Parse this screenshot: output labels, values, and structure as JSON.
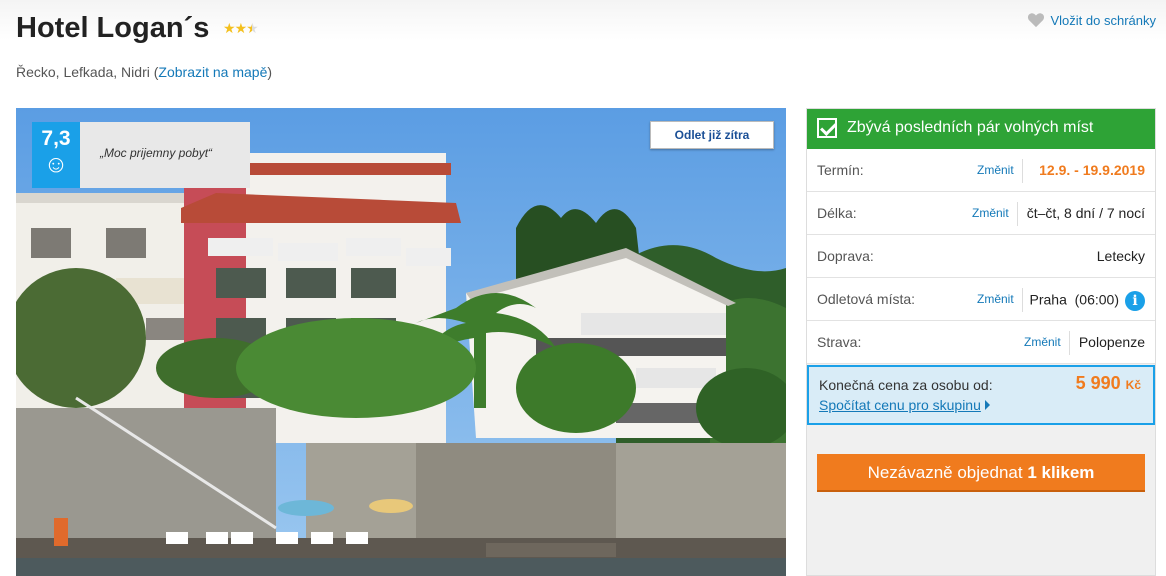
{
  "hotel": {
    "name": "Hotel Logan´s",
    "stars": 2.5,
    "location_prefix": "Řecko, Lefkada, Nidri (",
    "map_link": "Zobrazit na mapě",
    "location_suffix": ")"
  },
  "favorites": {
    "label": "Vložit do schránky"
  },
  "photo": {
    "rating_score": "7,3",
    "rating_quote": "„Moc prijemny pobyt“",
    "badge": "Odlet již zítra"
  },
  "panel": {
    "availability": "Zbývá posledních pár volných míst",
    "rows": [
      {
        "label": "Termín:",
        "change": "Změnit",
        "value": "12.9. - 19.9.2019"
      },
      {
        "label": "Délka:",
        "change": "Změnit",
        "value": "čt–čt, 8 dní / 7 nocí"
      },
      {
        "label": "Doprava:",
        "change": "",
        "value": "Letecky"
      },
      {
        "label": "Odletová místa:",
        "change": "Změnit",
        "value": "Praha  (06:00)"
      },
      {
        "label": "Strava:",
        "change": "Změnit",
        "value": "Polopenze"
      }
    ],
    "price_label": "Konečná cena za osobu od:",
    "price_value": "5 990",
    "price_currency": "Kč",
    "group_link": "Spočítat cenu pro skupinu",
    "order_button_prefix": "Nezávazně objednat ",
    "order_button_bold": "1 klikem"
  },
  "colors": {
    "accent_blue": "#1aa0e8",
    "link_blue": "#1479b8",
    "orange": "#f07b1e",
    "green": "#2ea336"
  }
}
